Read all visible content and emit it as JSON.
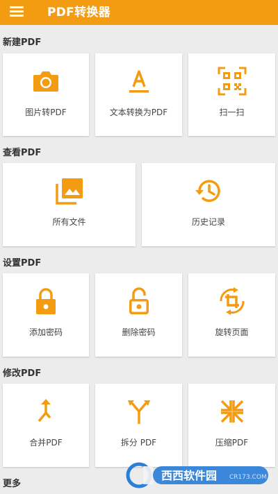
{
  "app": {
    "title": "PDF转换器"
  },
  "sections": [
    {
      "title": "新建PDF",
      "items": [
        {
          "label": "图片转PDF"
        },
        {
          "label": "文本转换为PDF"
        },
        {
          "label": "扫一扫"
        }
      ]
    },
    {
      "title": "查看PDF",
      "items": [
        {
          "label": "所有文件"
        },
        {
          "label": "历史记录"
        }
      ]
    },
    {
      "title": "设置PDF",
      "items": [
        {
          "label": "添加密码"
        },
        {
          "label": "删除密码"
        },
        {
          "label": "旋转页面"
        }
      ]
    },
    {
      "title": "修改PDF",
      "items": [
        {
          "label": "合并PDF"
        },
        {
          "label": "拆分 PDF"
        },
        {
          "label": "压缩PDF"
        }
      ]
    },
    {
      "title": "更多"
    }
  ],
  "watermark": {
    "brand": "西西软件园",
    "site": "CR173.COM"
  },
  "colors": {
    "accent": "#f39c12",
    "background": "#ececec",
    "card": "#ffffff"
  }
}
